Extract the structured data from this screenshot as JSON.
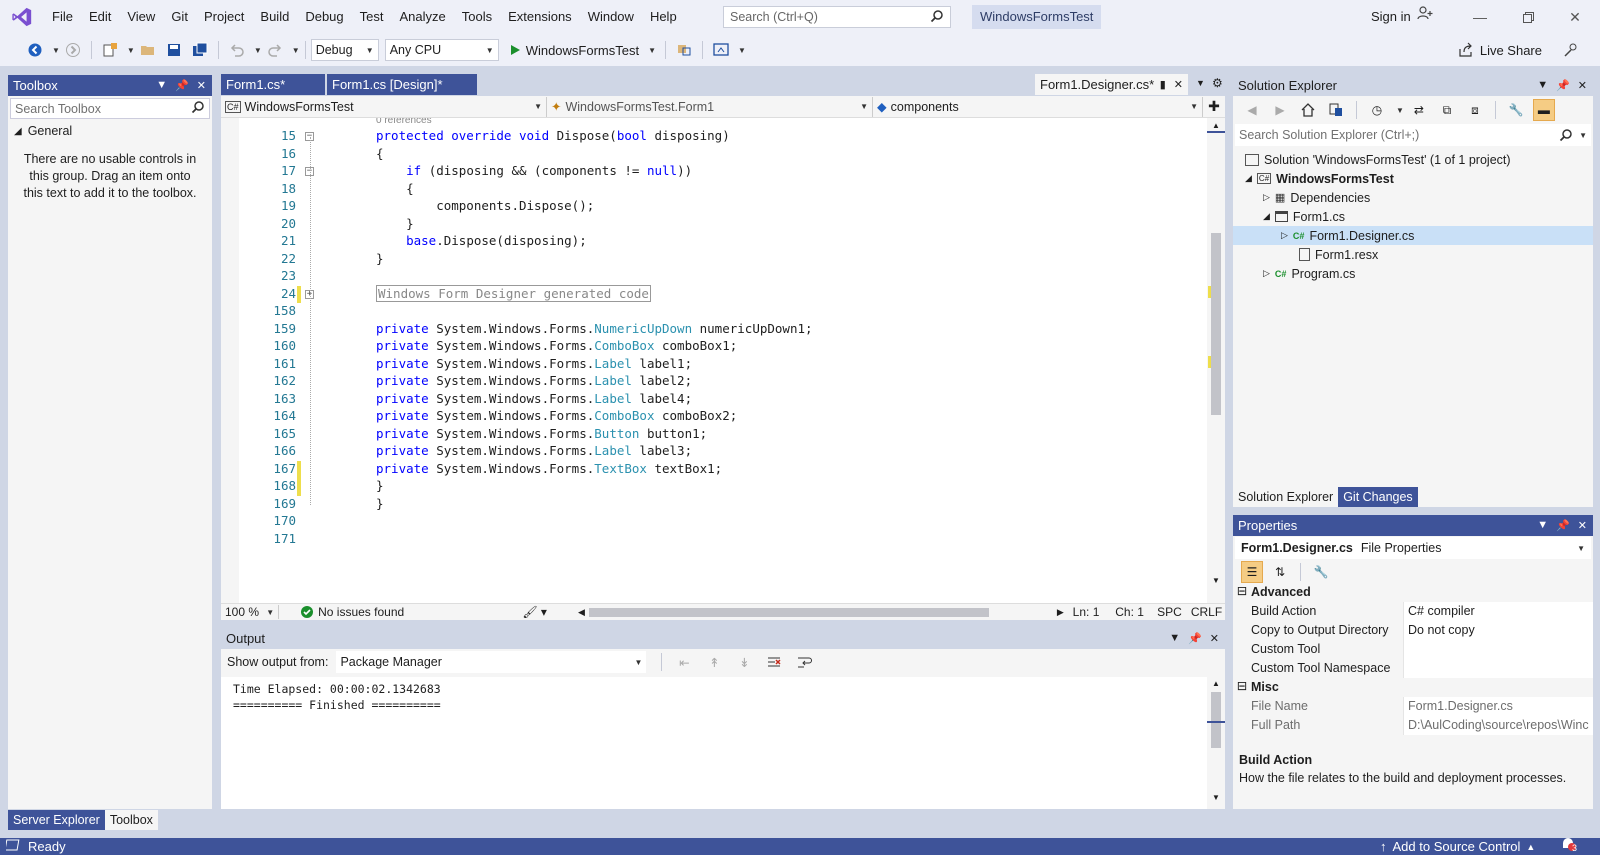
{
  "titlebar": {
    "menu": [
      "File",
      "Edit",
      "View",
      "Git",
      "Project",
      "Build",
      "Debug",
      "Test",
      "Analyze",
      "Tools",
      "Extensions",
      "Window",
      "Help"
    ],
    "search_placeholder": "Search (Ctrl+Q)",
    "solution_name": "WindowsFormsTest",
    "sign_in": "Sign in"
  },
  "toolbar": {
    "config": "Debug",
    "platform": "Any CPU",
    "start_target": "WindowsFormsTest",
    "live_share": "Live Share"
  },
  "toolbox": {
    "title": "Toolbox",
    "search_placeholder": "Search Toolbox",
    "group": "General",
    "empty_message": "There are no usable controls in this group. Drag an item onto this text to add it to the toolbox.",
    "tabs": [
      "Server Explorer",
      "Toolbox"
    ]
  },
  "editor": {
    "tabs": [
      "Form1.cs*",
      "Form1.cs [Design]*"
    ],
    "active_tab": "Form1.Designer.cs*",
    "nav": {
      "project": "WindowsFormsTest",
      "class": "WindowsFormsTest.Form1",
      "member": "components"
    },
    "references": "0 references",
    "lines": [
      {
        "n": "15",
        "code": [
          [
            "kw",
            "protected override void "
          ],
          [
            "",
            "Dispose("
          ],
          [
            "kw",
            "bool"
          ],
          [
            "",
            " disposing)"
          ]
        ]
      },
      {
        "n": "16",
        "code": [
          [
            "",
            "{"
          ]
        ]
      },
      {
        "n": "17",
        "code": [
          [
            "",
            "    "
          ],
          [
            "kw",
            "if"
          ],
          [
            "",
            " (disposing && (components != "
          ],
          [
            "kw",
            "null"
          ],
          [
            "",
            "))"
          ]
        ]
      },
      {
        "n": "18",
        "code": [
          [
            "",
            "    {"
          ]
        ]
      },
      {
        "n": "19",
        "code": [
          [
            "",
            "        components.Dispose();"
          ]
        ]
      },
      {
        "n": "20",
        "code": [
          [
            "",
            "    }"
          ]
        ]
      },
      {
        "n": "21",
        "code": [
          [
            "",
            "    "
          ],
          [
            "kw",
            "base"
          ],
          [
            "",
            ".Dispose(disposing);"
          ]
        ]
      },
      {
        "n": "22",
        "code": [
          [
            "",
            "}"
          ]
        ]
      },
      {
        "n": "23",
        "code": []
      },
      {
        "n": "24",
        "code": [
          [
            "box",
            "Windows Form Designer generated code"
          ]
        ]
      },
      {
        "n": "158",
        "code": []
      },
      {
        "n": "159",
        "code": [
          [
            "kw",
            "private "
          ],
          [
            "",
            "System.Windows.Forms."
          ],
          [
            "ty",
            "NumericUpDown"
          ],
          [
            "",
            " numericUpDown1;"
          ]
        ]
      },
      {
        "n": "160",
        "code": [
          [
            "kw",
            "private "
          ],
          [
            "",
            "System.Windows.Forms."
          ],
          [
            "ty",
            "ComboBox"
          ],
          [
            "",
            " comboBox1;"
          ]
        ]
      },
      {
        "n": "161",
        "code": [
          [
            "kw",
            "private "
          ],
          [
            "",
            "System.Windows.Forms."
          ],
          [
            "ty",
            "Label"
          ],
          [
            "",
            " label1;"
          ]
        ]
      },
      {
        "n": "162",
        "code": [
          [
            "kw",
            "private "
          ],
          [
            "",
            "System.Windows.Forms."
          ],
          [
            "ty",
            "Label"
          ],
          [
            "",
            " label2;"
          ]
        ]
      },
      {
        "n": "163",
        "code": [
          [
            "kw",
            "private "
          ],
          [
            "",
            "System.Windows.Forms."
          ],
          [
            "ty",
            "Label"
          ],
          [
            "",
            " label4;"
          ]
        ]
      },
      {
        "n": "164",
        "code": [
          [
            "kw",
            "private "
          ],
          [
            "",
            "System.Windows.Forms."
          ],
          [
            "ty",
            "ComboBox"
          ],
          [
            "",
            " comboBox2;"
          ]
        ]
      },
      {
        "n": "165",
        "code": [
          [
            "kw",
            "private "
          ],
          [
            "",
            "System.Windows.Forms."
          ],
          [
            "ty",
            "Button"
          ],
          [
            "",
            " button1;"
          ]
        ]
      },
      {
        "n": "166",
        "code": [
          [
            "kw",
            "private "
          ],
          [
            "",
            "System.Windows.Forms."
          ],
          [
            "ty",
            "Label"
          ],
          [
            "",
            " label3;"
          ]
        ]
      },
      {
        "n": "167",
        "code": [
          [
            "kw",
            "private "
          ],
          [
            "",
            "System.Windows.Forms."
          ],
          [
            "ty",
            "TextBox"
          ],
          [
            "",
            " textBox1;"
          ]
        ]
      },
      {
        "n": "168",
        "code": [
          [
            "",
            "}"
          ]
        ]
      },
      {
        "n": "169",
        "code": [
          [
            "",
            "}"
          ]
        ]
      },
      {
        "n": "170",
        "code": []
      },
      {
        "n": "171",
        "code": []
      }
    ],
    "status": {
      "zoom": "100 %",
      "issues": "No issues found",
      "ln": "Ln: 1",
      "ch": "Ch: 1",
      "spc": "SPC",
      "eol": "CRLF"
    }
  },
  "output": {
    "title": "Output",
    "show_from_label": "Show output from:",
    "source": "Package Manager",
    "lines": [
      "Time Elapsed: 00:00:02.1342683",
      "========== Finished =========="
    ]
  },
  "solution_explorer": {
    "title": "Solution Explorer",
    "search_placeholder": "Search Solution Explorer (Ctrl+;)",
    "solution": "Solution 'WindowsFormsTest' (1 of 1 project)",
    "project": "WindowsFormsTest",
    "dependencies": "Dependencies",
    "form": "Form1.cs",
    "designer": "Form1.Designer.cs",
    "resx": "Form1.resx",
    "program": "Program.cs",
    "tabs": [
      "Solution Explorer",
      "Git Changes"
    ]
  },
  "properties": {
    "title": "Properties",
    "object": "Form1.Designer.cs",
    "object_type": "File Properties",
    "cat_advanced": "Advanced",
    "cat_misc": "Misc",
    "rows": [
      {
        "name": "Build Action",
        "value": "C# compiler"
      },
      {
        "name": "Copy to Output Directory",
        "value": "Do not copy"
      },
      {
        "name": "Custom Tool",
        "value": ""
      },
      {
        "name": "Custom Tool Namespace",
        "value": ""
      }
    ],
    "misc_rows": [
      {
        "name": "File Name",
        "value": "Form1.Designer.cs"
      },
      {
        "name": "Full Path",
        "value": "D:\\AulCoding\\source\\repos\\Winc"
      }
    ],
    "desc_title": "Build Action",
    "desc_text": "How the file relates to the build and deployment processes."
  },
  "statusbar": {
    "ready": "Ready",
    "source_control": "Add to Source Control",
    "notifications": "3"
  },
  "colors": {
    "accent": "#3e5399",
    "keyword": "#0000ff",
    "type": "#2b91af"
  }
}
